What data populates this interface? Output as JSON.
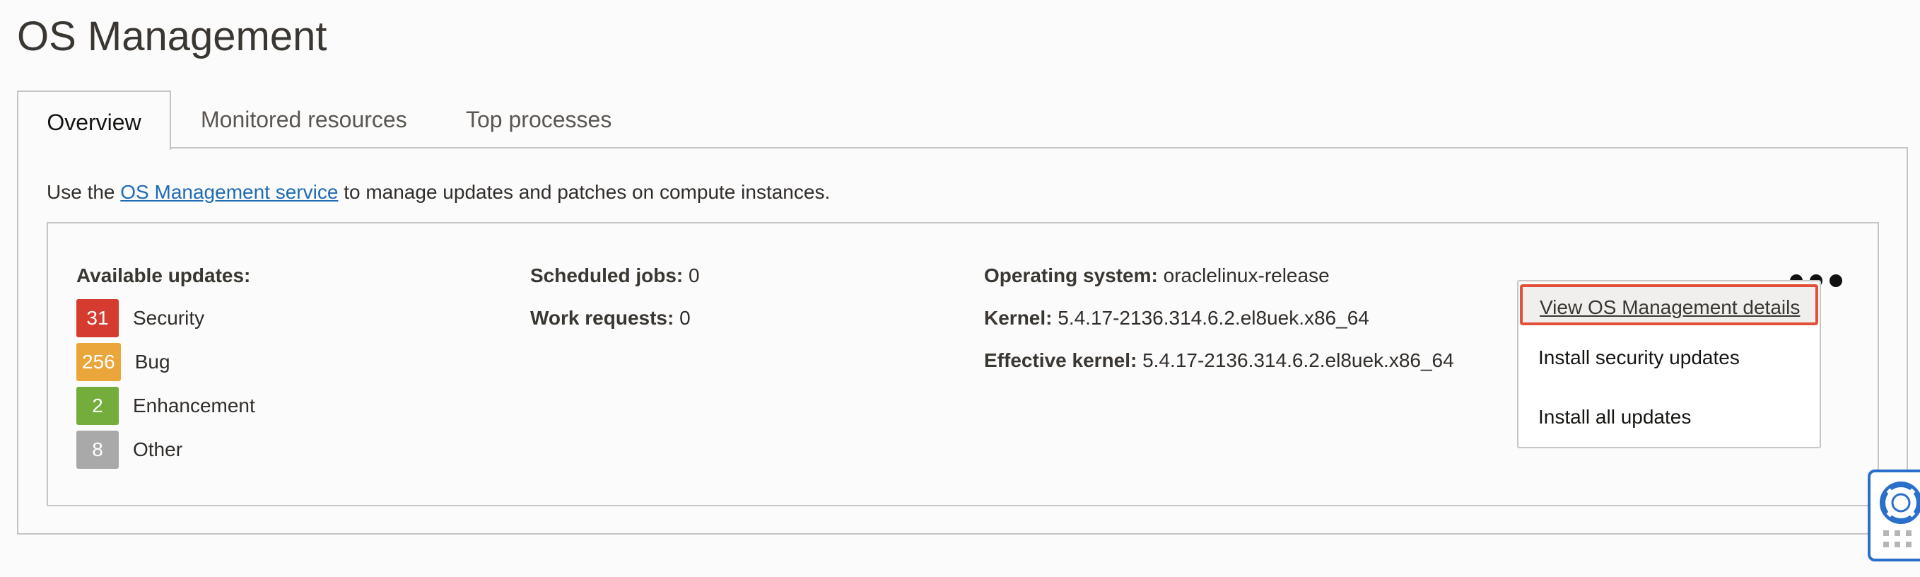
{
  "page": {
    "title": "OS Management"
  },
  "tabs": [
    {
      "label": "Overview",
      "active": true
    },
    {
      "label": "Monitored resources",
      "active": false
    },
    {
      "label": "Top processes",
      "active": false
    }
  ],
  "intro": {
    "prefix": "Use the ",
    "link": "OS Management service",
    "suffix": " to manage updates and patches on compute instances."
  },
  "available_updates": {
    "label": "Available updates:",
    "items": [
      {
        "count": "31",
        "label": "Security",
        "color": "#d63b30"
      },
      {
        "count": "256",
        "label": "Bug",
        "color": "#eaa63a"
      },
      {
        "count": "2",
        "label": "Enhancement",
        "color": "#74ad3c"
      },
      {
        "count": "8",
        "label": "Other",
        "color": "#a9a9a9"
      }
    ]
  },
  "jobs": {
    "scheduled_label": "Scheduled jobs:",
    "scheduled_value": "0",
    "work_label": "Work requests:",
    "work_value": "0"
  },
  "system": {
    "os_label": "Operating system:",
    "os_value": "oraclelinux-release",
    "kernel_label": "Kernel:",
    "kernel_value": "5.4.17-2136.314.6.2.el8uek.x86_64",
    "eff_kernel_label": "Effective kernel:",
    "eff_kernel_value": "5.4.17-2136.314.6.2.el8uek.x86_64"
  },
  "menu": {
    "items": [
      {
        "label": "View OS Management details",
        "highlighted": true
      },
      {
        "label": "Install security updates",
        "highlighted": false
      },
      {
        "label": "Install all updates",
        "highlighted": false
      }
    ]
  },
  "icons": {
    "actions": "ellipsis-icon",
    "help": "lifebuoy-icon"
  },
  "colors": {
    "link": "#1f6bb5",
    "highlight_border": "#e2503a",
    "help_widget": "#2a6fc9"
  }
}
